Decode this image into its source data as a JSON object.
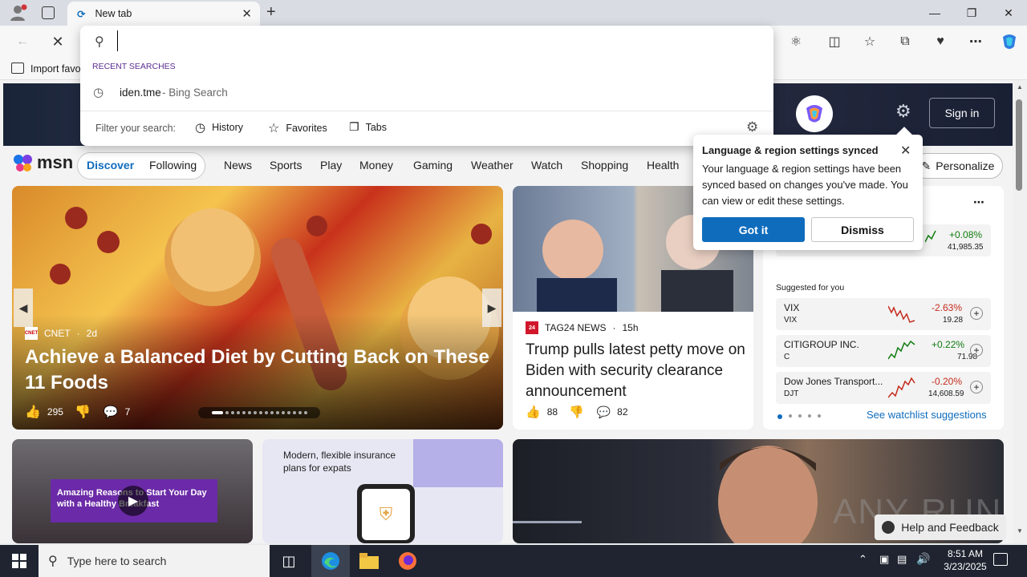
{
  "browser": {
    "tab_title": "New tab",
    "favorites_bar": "Import favo",
    "address_value": "",
    "window_controls": [
      "minimize",
      "restore",
      "close"
    ]
  },
  "dropdown": {
    "recent_label": "RECENT SEARCHES",
    "recent_item": "iden.tme",
    "recent_item_suffix": " - Bing Search",
    "filter_label": "Filter your search:",
    "filters": [
      "History",
      "Favorites",
      "Tabs"
    ]
  },
  "msn": {
    "logo": "msn",
    "sign_in": "Sign in",
    "tabs": [
      "Discover",
      "Following"
    ],
    "nav": [
      "News",
      "Sports",
      "Play",
      "Money",
      "Gaming",
      "Weather",
      "Watch",
      "Shopping",
      "Health"
    ],
    "personalize": "Personalize"
  },
  "popup": {
    "title": "Language & region settings synced",
    "body": "Your language & region settings have been synced based on changes you've made. You can view or edit these settings.",
    "got_it": "Got it",
    "dismiss": "Dismiss"
  },
  "big_card": {
    "source": "CNET",
    "age": "2d",
    "headline": "Achieve a Balanced Diet by Cutting Back on These 11 Foods",
    "likes": "295",
    "comments": "7"
  },
  "trump_card": {
    "source": "TAG24 NEWS",
    "age": "15h",
    "headline": "Trump pulls latest petty move on Biden with security clearance announcement",
    "likes": "88",
    "comments": "82"
  },
  "watchlist": {
    "top_change": "+0.08%",
    "top_value": "41,985.35",
    "suggested_label": "Suggested for you",
    "stocks": [
      {
        "name": "VIX",
        "ticker": "VIX",
        "change": "-2.63%",
        "price": "19.28",
        "trend": "down"
      },
      {
        "name": "CITIGROUP INC.",
        "ticker": "C",
        "change": "+0.22%",
        "price": "71.98",
        "trend": "up"
      },
      {
        "name": "Dow Jones Transport...",
        "ticker": "DJT",
        "change": "-0.20%",
        "price": "14,608.59",
        "trend": "down"
      }
    ],
    "see_more": "See watchlist suggestions"
  },
  "row2": {
    "video_caption": "Amazing Reasons to Start Your Day with a Healthy Breakfast",
    "ad_text": "Modern, flexible insurance plans for expats"
  },
  "help": "Help and Feedback",
  "watermark": "ANY RUN",
  "taskbar": {
    "search_placeholder": "Type here to search",
    "time": "8:51 AM",
    "date": "3/23/2025"
  },
  "colors": {
    "accent": "#0f6cbd",
    "positive": "#107c10",
    "negative": "#c42b1c"
  }
}
